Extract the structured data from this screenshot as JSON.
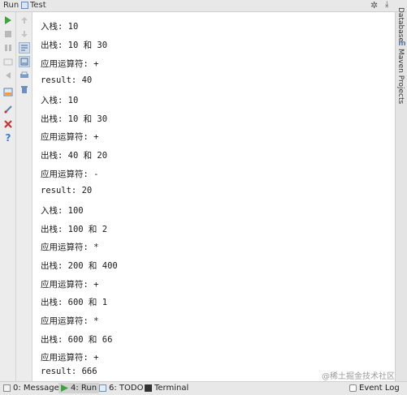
{
  "titlebar": {
    "run_label": "Run",
    "config_name": "Test"
  },
  "console": {
    "lines": [
      "入栈: 10",
      "出栈: 10 和 30",
      "应用运算符: +",
      "result: 40",
      "入栈: 10",
      "出栈: 10 和 30",
      "应用运算符: +",
      "出栈: 40 和 20",
      "应用运算符: -",
      "result: 20",
      "入栈: 100",
      "出栈: 100 和 2",
      "应用运算符: *",
      "出栈: 200 和 400",
      "应用运算符: +",
      "出栈: 600 和 1",
      "应用运算符: *",
      "出栈: 600 和 66",
      "应用运算符: +",
      "result: 666"
    ],
    "watermark": "@稀土掘金技术社区"
  },
  "rightbar": {
    "database_label": "Database",
    "maven_label": "Maven Projects"
  },
  "statusbar": {
    "messages": "0: Messages",
    "run": "4: Run",
    "todo": "6: TODO",
    "terminal": "Terminal",
    "event_log": "Event Log"
  },
  "colors": {
    "run_green": "#3aa63a",
    "stop_red": "#cc2e2e",
    "help_blue": "#3a7bd5"
  }
}
